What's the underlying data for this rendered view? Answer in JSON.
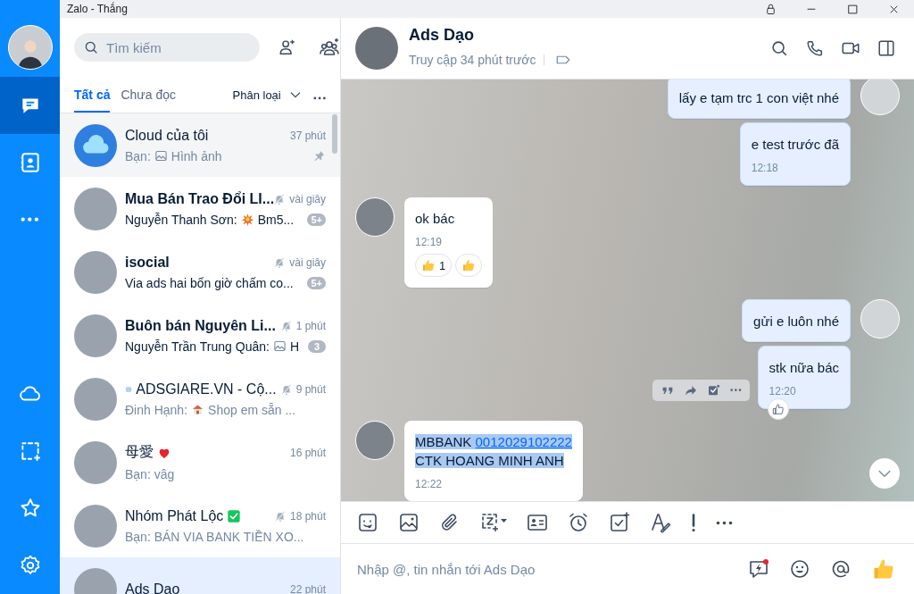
{
  "window": {
    "title": "Zalo - Thắng"
  },
  "nav": {
    "top_items": [
      {
        "kind": "chat",
        "selected": true
      },
      {
        "kind": "contacts",
        "selected": false
      },
      {
        "kind": "more",
        "selected": false
      }
    ],
    "bottom_items": [
      {
        "kind": "cloud",
        "selected": false
      },
      {
        "kind": "screenshot",
        "selected": false
      },
      {
        "kind": "star",
        "selected": false
      },
      {
        "kind": "settings",
        "selected": false
      }
    ]
  },
  "search": {
    "placeholder": "Tìm kiếm"
  },
  "filter_tabs": [
    {
      "label": "Tất cả",
      "selected": true
    },
    {
      "label": "Chưa đọc",
      "selected": false
    }
  ],
  "sort": {
    "label": "Phân loại"
  },
  "conversations": [
    {
      "kind": "cloud",
      "name": [
        {
          "kind": "text",
          "text": "Cloud của tôi"
        }
      ],
      "time": "37 phút",
      "preview": [
        {
          "kind": "text",
          "text": "Bạn:"
        },
        {
          "kind": "image"
        },
        {
          "kind": "text",
          "text": "Hình ảnh"
        }
      ],
      "unread": false,
      "muted": false,
      "pinned": true,
      "highlighted": true,
      "selected": false
    },
    {
      "kind": "photo",
      "name": [
        {
          "kind": "text",
          "text": "Mua Bán Trao Đổi LI..."
        }
      ],
      "time": "vài giây",
      "preview": [
        {
          "kind": "text",
          "text": "Nguyễn Thanh Sơn:"
        },
        {
          "kind": "burst"
        },
        {
          "kind": "text",
          "text": "Bm5..."
        }
      ],
      "badge": "5+",
      "unread": true,
      "muted": true,
      "pinned": false,
      "highlighted": false,
      "selected": false
    },
    {
      "kind": "photo",
      "name": [
        {
          "kind": "text",
          "text": "isocial"
        }
      ],
      "time": "vài giây",
      "preview": [
        {
          "kind": "text",
          "text": "Via ads hai bốn giờ chấm co..."
        }
      ],
      "badge": "5+",
      "unread": true,
      "muted": true,
      "pinned": false,
      "highlighted": false,
      "selected": false
    },
    {
      "kind": "photo",
      "name": [
        {
          "kind": "text",
          "text": "Buôn bán Nguyên Li..."
        }
      ],
      "time": "1 phút",
      "preview": [
        {
          "kind": "text",
          "text": "Nguyễn Trần Trung Quân:"
        },
        {
          "kind": "image"
        },
        {
          "kind": "text",
          "text": "H"
        }
      ],
      "badge": "3",
      "unread": true,
      "muted": true,
      "pinned": false,
      "highlighted": false,
      "selected": false
    },
    {
      "kind": "photo",
      "name": [
        {
          "kind": "globe"
        },
        {
          "kind": "text",
          "text": "ADSGIARE.VN - Cộ..."
        }
      ],
      "time": "9 phút",
      "preview": [
        {
          "kind": "text",
          "text": "Đinh Hạnh:"
        },
        {
          "kind": "house"
        },
        {
          "kind": "text",
          "text": "Shop em sẵn ..."
        }
      ],
      "unread": false,
      "muted": true,
      "pinned": false,
      "highlighted": false,
      "selected": false
    },
    {
      "kind": "photo",
      "name": [
        {
          "kind": "text",
          "text": "母愛"
        },
        {
          "kind": "heart"
        }
      ],
      "time": "16 phút",
      "preview": [
        {
          "kind": "text",
          "text": "Bạn: vâg"
        }
      ],
      "unread": false,
      "muted": false,
      "pinned": false,
      "highlighted": false,
      "selected": false
    },
    {
      "kind": "photo",
      "name": [
        {
          "kind": "text",
          "text": "Nhóm Phát Lộc"
        },
        {
          "kind": "check"
        }
      ],
      "time": "18 phút",
      "preview": [
        {
          "kind": "text",
          "text": "Bạn: BÁN VIA BANK TIỀN XO..."
        }
      ],
      "unread": false,
      "muted": true,
      "pinned": false,
      "highlighted": false,
      "selected": false
    },
    {
      "kind": "photo",
      "name": [
        {
          "kind": "text",
          "text": "Ads Dao"
        }
      ],
      "time": "22 phút",
      "unread": false,
      "muted": false,
      "pinned": false,
      "highlighted": false,
      "selected": true
    }
  ],
  "chat": {
    "name": "Ads Dạo",
    "status": "Truy cập 34 phút trước",
    "messages": [
      {
        "kind": "out",
        "show_avatar": true,
        "segments": [
          {
            "kind": "plain",
            "text": "lấy e tạm trc 1 con việt nhé"
          }
        ]
      },
      {
        "kind": "out",
        "show_avatar": false,
        "segments": [
          {
            "kind": "plain",
            "text": "e test trước đã"
          }
        ],
        "time": "12:18"
      },
      {
        "kind": "in",
        "show_avatar": true,
        "segments": [
          {
            "kind": "plain",
            "text": "ok bác"
          }
        ],
        "time": "12:19",
        "reaction_count": "1"
      },
      {
        "kind": "out",
        "show_avatar": true,
        "segments": [
          {
            "kind": "plain",
            "text": "gửi e luôn nhé"
          }
        ]
      },
      {
        "kind": "out",
        "show_avatar": false,
        "segments": [
          {
            "kind": "plain",
            "text": "stk nữa bác"
          }
        ],
        "time": "12:20",
        "hover_actions": true
      },
      {
        "kind": "in",
        "show_avatar": true,
        "highlighted_text": true,
        "segments": [
          {
            "kind": "plain",
            "text": "MBBANK "
          },
          {
            "kind": "link",
            "text": "0012029102222"
          },
          {
            "kind": "break"
          },
          {
            "kind": "plain",
            "text": " CTK HOANG MINH ANH"
          }
        ],
        "time": "12:22"
      }
    ]
  },
  "composer": {
    "placeholder": "Nhập @, tin nhắn tới Ads Dạo"
  }
}
